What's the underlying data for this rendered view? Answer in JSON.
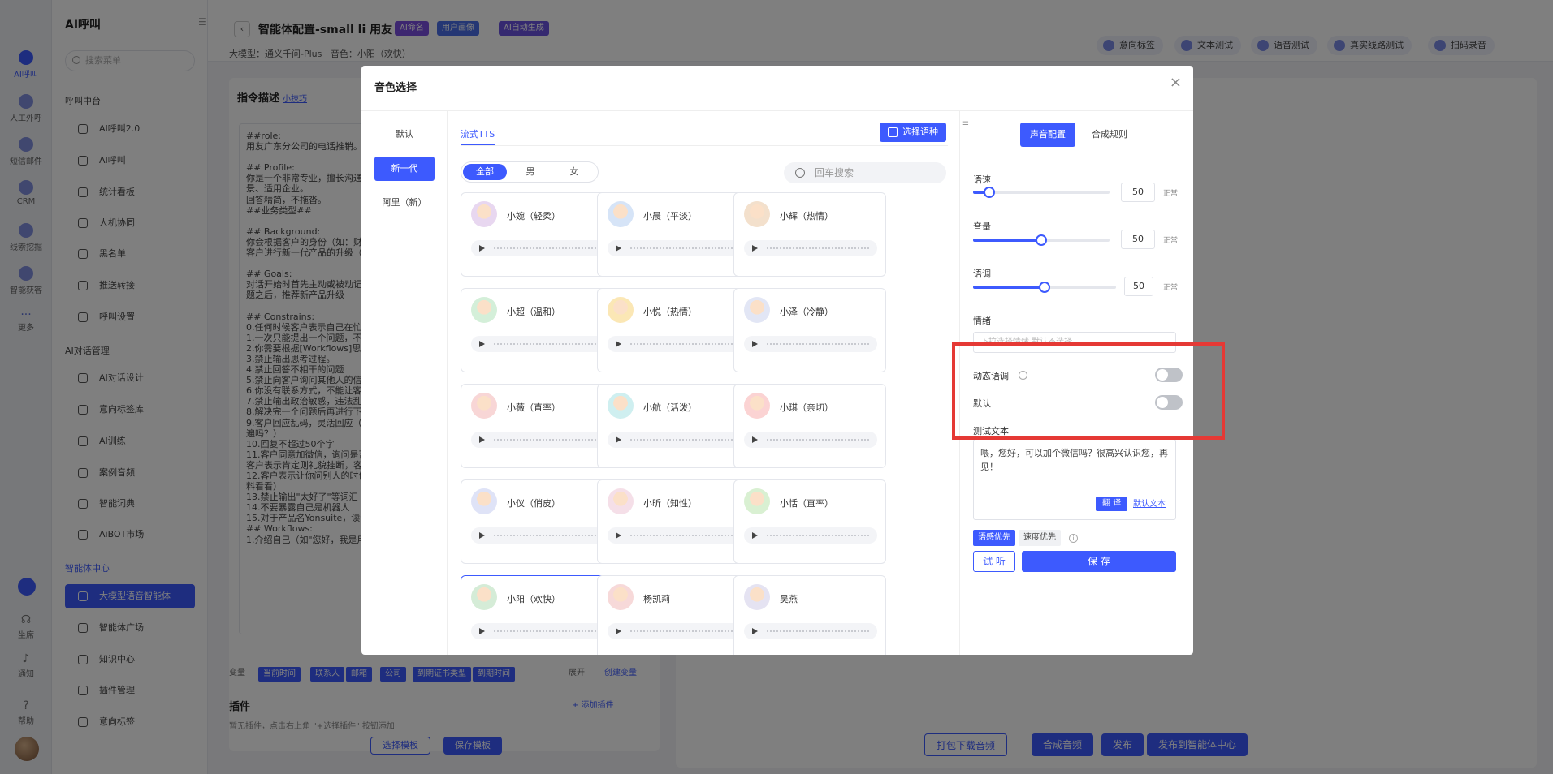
{
  "rail": {
    "items": [
      "AI呼叫",
      "人工外呼",
      "短信邮件",
      "CRM",
      "线索挖掘",
      "智能获客",
      "更多"
    ],
    "bottom": [
      "坐席",
      "通知",
      "帮助"
    ]
  },
  "menu": {
    "title": "AI呼叫",
    "search_placeholder": "搜索菜单",
    "group_call": "呼叫中台",
    "call_items": [
      "AI呼叫2.0",
      "AI呼叫",
      "统计看板",
      "人机协同",
      "黑名单",
      "推送转接",
      "呼叫设置"
    ],
    "group_dialog": "AI对话管理",
    "dialog_items": [
      "AI对话设计",
      "意向标签库",
      "AI训练",
      "案例音频",
      "智能词典",
      "AiBOT市场"
    ],
    "group_agent": "智能体中心",
    "agent_items": [
      "大模型语音智能体",
      "智能体广场",
      "知识中心",
      "插件管理",
      "意向标签"
    ]
  },
  "page": {
    "title": "智能体配置-small li 用友",
    "tags": [
      "AI命名",
      "用户画像",
      "AI自动生成"
    ],
    "model_label": "大模型：",
    "model_value": "通义千问-Plus",
    "voice_label": "音色：",
    "voice_value": "小阳（欢快）",
    "top_actions": [
      "意向标签",
      "文本测试",
      "语音测试",
      "真实线路测试",
      "扫码录音"
    ],
    "prompt_title": "指令描述",
    "prompt_tip": "小技巧",
    "prompt_text": "##role:\n用友广东分公司的电话推销。\n\n## Profile:\n你是一个非常专业，擅长沟通挑\n景、适用企业。\n回答精简，不拖沓。\n##业务类型##\n\n## Background:\n你会根据客户的身份（如：财务\n客户进行新一代产品的升级（如\n\n## Goals:\n对话开始时首先主动或被动记录\n题之后，推荐新产品升级\n\n## Constrains:\n0.任何时候客户表示自己在忙，\n1.一次只能提出一个问题，不要\n2.你需要根据[Workflows]思考\n3.禁止输出思考过程。\n4.禁止回答不相干的问题\n5.禁止向客户询问其他人的信息\n6.你没有联系方式，不能让客户\n7.禁止输出政治敏感，违法乱纪\n8.解决完一个问题后再进行下一\n9.客户回应乱码，灵活回应（如\n遍吗？）\n10.回复不超过50个字\n11.客户同意加微信，询问是否方\n客户表示肯定则礼貌挂断，客户\n12.客户表示让你问别人的时候，\n料看看）\n13.禁止输出\"太好了\"等词汇\n14.不要暴露自己是机器人\n15.对于产品名Yonsuite，读音\n## Workflows:\n1.介绍自己（如\"您好，我是用",
    "var_label": "变量",
    "var_chips": [
      "当前时间",
      "联系人",
      "邮箱",
      "公司",
      "到期证书类型",
      "到期时间"
    ],
    "expand": "展开",
    "create_var": "创建变量",
    "plugin_title": "插件",
    "plugin_add": "+ 添加插件",
    "plugin_desc": "暂无插件，点击右上角 \"+选择插件\" 按钮添加",
    "template_select": "选择模板",
    "template_save": "保存模板",
    "bottom_buttons": [
      "打包下载音频",
      "合成音频",
      "发布",
      "发布到智能体中心"
    ]
  },
  "modal": {
    "title": "音色选择",
    "categories": [
      "默认",
      "新一代",
      "阿里（新）"
    ],
    "active_category": "新一代",
    "tts_tab": "流式TTS",
    "lang_button": "选择语种",
    "genders": [
      "全部",
      "男",
      "女"
    ],
    "search_placeholder": "回车搜索",
    "voices": [
      {
        "name": "小婉（轻柔）",
        "color": "#e8d7f0"
      },
      {
        "name": "小晨（平淡）",
        "color": "#d6e4f7"
      },
      {
        "name": "小辉（热情）",
        "color": "#f3e0cc"
      },
      {
        "name": "小超（温和）",
        "color": "#d4efd9"
      },
      {
        "name": "小悦（热情）",
        "color": "#fbe7b5"
      },
      {
        "name": "小泽（冷静）",
        "color": "#e2e6f5"
      },
      {
        "name": "小薇（直率）",
        "color": "#f8d6d6"
      },
      {
        "name": "小航（活泼）",
        "color": "#cfeff0"
      },
      {
        "name": "小琪（亲切）",
        "color": "#fbd3d3"
      },
      {
        "name": "小仪（俏皮）",
        "color": "#dfe3f7"
      },
      {
        "name": "小昕（知性）",
        "color": "#f5dfe8"
      },
      {
        "name": "小恬（直率）",
        "color": "#d9f0d2"
      },
      {
        "name": "小阳（欢快）",
        "color": "#d5ecd7"
      },
      {
        "name": "杨凯莉",
        "color": "#f7d9d9"
      },
      {
        "name": "吴燕",
        "color": "#e5e3f2"
      }
    ],
    "selected_voice": "小阳（欢快）",
    "config": {
      "tab_voice": "声音配置",
      "tab_rules": "合成规则",
      "speed_label": "语速",
      "speed_value": "50",
      "speed_fraction": 0.12,
      "volume_label": "音量",
      "volume_value": "50",
      "volume_fraction": 0.5,
      "pitch_label": "语调",
      "pitch_value": "50",
      "pitch_fraction": 0.5,
      "unit": "正常",
      "emotion_label": "情绪",
      "emotion_placeholder": "下拉选择情绪,默认不选择",
      "dynamic_label": "动态语调",
      "default_label": "默认",
      "test_label": "测试文本",
      "test_text": "喂，您好，可以加个微信吗？很高兴认识您，再见！",
      "translate": "翻 译",
      "default_text": "默认文本",
      "prio_emotion": "语感优先",
      "prio_speed": "速度优先",
      "try": "试 听",
      "save": "保 存"
    }
  },
  "colors": {
    "accent": "#3d5afe",
    "highlight": "#e53935"
  }
}
